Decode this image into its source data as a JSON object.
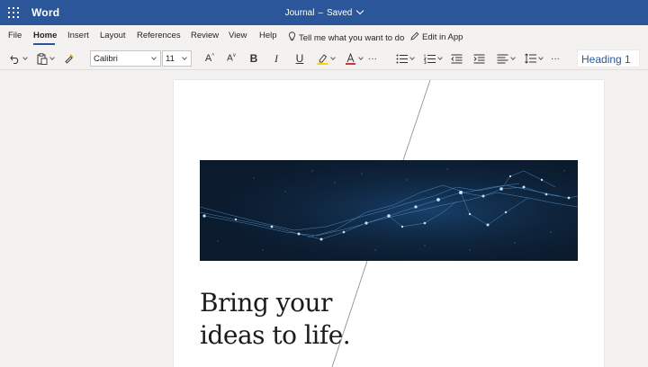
{
  "app": {
    "name": "Word"
  },
  "document": {
    "title": "Journal",
    "status": "Saved"
  },
  "menu": {
    "items": [
      {
        "id": "file",
        "label": "File"
      },
      {
        "id": "home",
        "label": "Home",
        "active": true
      },
      {
        "id": "insert",
        "label": "Insert"
      },
      {
        "id": "layout",
        "label": "Layout"
      },
      {
        "id": "references",
        "label": "References"
      },
      {
        "id": "review",
        "label": "Review"
      },
      {
        "id": "view",
        "label": "View"
      },
      {
        "id": "help",
        "label": "Help"
      }
    ],
    "tell_me": "Tell me what you want to do",
    "edit_in_app": "Edit in App"
  },
  "toolbar": {
    "font_name": "Calibri",
    "font_size": "11",
    "bold": "B",
    "italic": "I",
    "underline": "U",
    "more": "···",
    "style": "Heading 1"
  },
  "page": {
    "headline_line1": "Bring your",
    "headline_line2": "ideas to life."
  },
  "colors": {
    "accent": "#2b579a",
    "highlight": "#ffd400",
    "font_color": "#d13438",
    "hero_bg": "#0b1a2c"
  }
}
